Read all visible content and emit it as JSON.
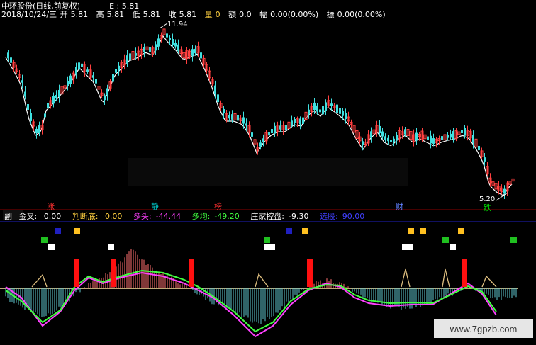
{
  "header": {
    "stock_name": "中环股份(日线,前复权)",
    "ma_label": "E",
    "ma_value": ": 5.81",
    "date": "2018/10/24/三",
    "open_label": "开",
    "open": "5.81",
    "high_label": "高",
    "high": "5.81",
    "low_label": "低",
    "low": "5.81",
    "close_label": "收",
    "close": "5.81",
    "volume_label": "量",
    "volume": "0",
    "amount_label": "额",
    "amount": "0.0",
    "change_label": "幅",
    "change": "0.00(0.00%)",
    "amplitude_label": "振",
    "amplitude": "0.00(0.00%)"
  },
  "price_annotations": {
    "high_mark": "11.94",
    "low_mark": "5.20"
  },
  "signal_labels": {
    "zhang": "涨",
    "zhang_color": "#ff3030",
    "jing": "静",
    "jing_color": "#00c0c0",
    "bang": "榜",
    "bang_color": "#ff3030",
    "cai": "财",
    "cai_color": "#6080ff",
    "die": "跌",
    "die_color": "#00e000"
  },
  "sub_panel": {
    "name": "副",
    "jincha_label": "金叉:",
    "jincha_value": "0.00",
    "jincha_color": "#ffffff",
    "pandidi_label": "判断底:",
    "pandidi_value": "0.00",
    "pandidi_color": "#ffd040",
    "duotou_label": "多头:",
    "duotou_value": "-44.44",
    "duotou_color": "#ff40ff",
    "duojun_label": "多均:",
    "duojun_value": "-49.20",
    "duojun_color": "#40ff40",
    "zhuang_label": "庄家控盘:",
    "zhuang_value": "-9.30",
    "zhuang_color": "#ffffff",
    "xuanxuan_label": "选股:",
    "xuanxuan_value": "90.00",
    "xuanxuan_color": "#4040ff"
  },
  "watermark": "www.7gpzb.com",
  "colors": {
    "up": "#ff4040",
    "down": "#40e0e0",
    "ma": "#ffffff",
    "divider": "#8b0000"
  }
}
